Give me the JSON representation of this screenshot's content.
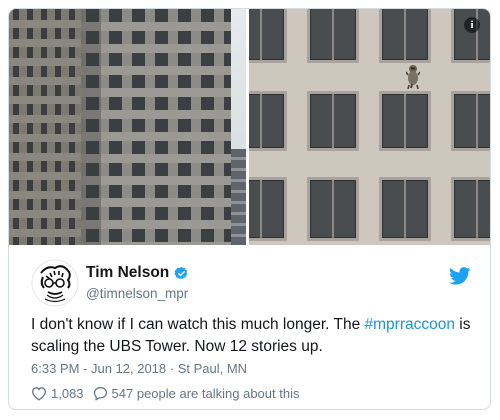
{
  "tweet": {
    "display_name": "Tim Nelson",
    "handle": "@timnelson_mpr",
    "text_before": "I don't know if I can watch this much longer. The ",
    "hashtag": "#mprraccoon",
    "text_after": " is scaling the UBS Tower. Now 12 stories up.",
    "timestamp": "6:33 PM - Jun 12, 2018",
    "separator": " · ",
    "location": "St Paul, MN",
    "like_count": "1,083",
    "talking_text": "547 people are talking about this"
  },
  "icons": {
    "info": "info-icon",
    "verified": "verified-badge-icon",
    "bird": "twitter-bird-icon",
    "like": "heart-icon",
    "reply": "speech-bubble-icon"
  },
  "info_glyph": "i",
  "colors": {
    "link": "#1b95e0",
    "secondary_text": "#657786",
    "primary_text": "#14171a",
    "border": "#d4dbe1"
  }
}
